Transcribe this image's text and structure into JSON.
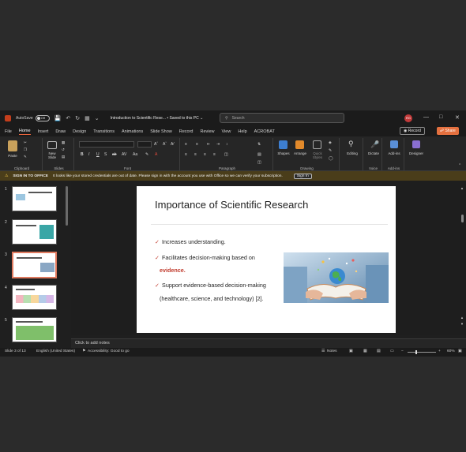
{
  "titlebar": {
    "autosave_label": "AutoSave",
    "autosave_state": "Off",
    "doc_title": "Introduction to Scientific Rese... • Saved to this PC ⌄",
    "search_placeholder": "Search",
    "user_initials": "RG"
  },
  "menu": {
    "tabs": [
      "File",
      "Home",
      "Insert",
      "Draw",
      "Design",
      "Transitions",
      "Animations",
      "Slide Show",
      "Record",
      "Review",
      "View",
      "Help",
      "ACROBAT"
    ],
    "active": "Home",
    "record_label": "Record",
    "share_label": "Share"
  },
  "ribbon": {
    "paste_label": "Paste",
    "new_slide_label": "New Slide",
    "shapes_label": "Shapes",
    "arrange_label": "Arrange",
    "quick_styles_label": "Quick Styles",
    "editing_label": "Editing",
    "dictate_label": "Dictate",
    "addins_label": "Add-ins",
    "designer_label": "Designer",
    "groups": {
      "clipboard": "Clipboard",
      "slides": "Slides",
      "font": "Font",
      "paragraph": "Paragraph",
      "drawing": "Drawing",
      "voice": "Voice",
      "addins": "Add-ins"
    }
  },
  "banner": {
    "title": "SIGN IN TO OFFICE",
    "message": "It looks like your stored credentials are out of date. Please sign in with the account you use with Office so we can verify your subscription.",
    "button": "Sign In"
  },
  "thumbnails": [
    "1",
    "2",
    "3",
    "4",
    "5"
  ],
  "slide": {
    "title": "Importance of Scientific Research",
    "bullet1": "Increases understanding.",
    "bullet2_a": "Facilitates decision-making based on",
    "bullet2_b": "evidence.",
    "bullet3_a": "Support evidence-based decision-making",
    "bullet3_b": "(healthcare, science, and technology) [2]."
  },
  "notes_placeholder": "Click to add notes",
  "status": {
    "slide": "Slide 3 of 13",
    "language": "English (United States)",
    "accessibility": "Accessibility: Good to go",
    "notes": "Notes",
    "zoom": "60%"
  },
  "colors": {
    "accent": "#e8643c",
    "check": "#c0392b",
    "banner_bg": "#4a3d1a"
  }
}
